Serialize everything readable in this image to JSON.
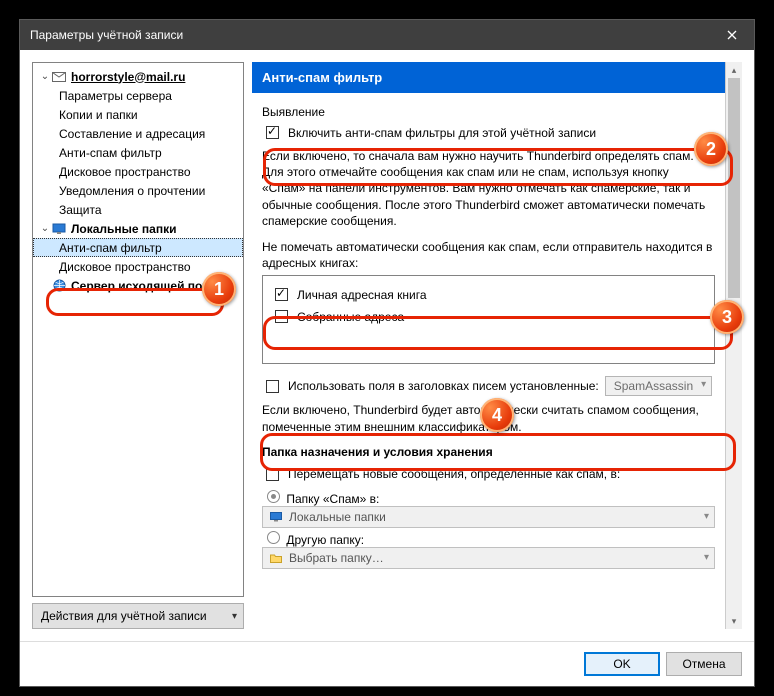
{
  "window": {
    "title": "Параметры учётной записи"
  },
  "sidebar": {
    "account_email": "horrorstyle@mail.ru",
    "items_account": [
      "Параметры сервера",
      "Копии и папки",
      "Составление и адресация",
      "Анти-спам фильтр",
      "Дисковое пространство",
      "Уведомления о прочтении",
      "Защита"
    ],
    "local_folders_label": "Локальные папки",
    "items_local": [
      "Анти-спам фильтр",
      "Дисковое пространство"
    ],
    "outgoing_label": "Сервер исходящей поч…",
    "actions_button": "Действия для учётной записи"
  },
  "panel": {
    "header": "Анти-спам фильтр",
    "section_detection_title": "Выявление",
    "enable_label": "Включить анти-спам фильтры для этой учётной записи",
    "enable_checked": true,
    "enable_desc": "Если включено, то сначала вам нужно научить Thunderbird определять спам. Для этого отмечайте сообщения как спам или не спам, используя кнопку «Спам» на панели инструментов. Вам нужно отмечать как спамерские, так и обычные сообщения. После этого Thunderbird сможет автоматически помечать спамерские сообщения.",
    "ab_desc": "Не помечать автоматически сообщения как спам, если отправитель находится в адресных книгах:",
    "ab_personal_label": "Личная адресная книга",
    "ab_personal_checked": true,
    "ab_collected_label": "Собранные адреса",
    "ab_collected_checked": false,
    "headers_label": "Использовать поля в заголовках писем установленные:",
    "headers_checked": false,
    "headers_select_value": "SpamAssassin",
    "headers_desc": "Если включено, Thunderbird будет автоматически считать спамом сообщения, помеченные этим внешним классификатором.",
    "dest_section_title": "Папка назначения и условия хранения",
    "move_label": "Перемещать новые сообщения, определённые как спам, в:",
    "move_checked": false,
    "radio_junk_label": "Папку «Спам» в:",
    "radio_junk_select": "Локальные папки",
    "radio_other_label": "Другую папку:",
    "radio_other_select": "Выбрать папку…"
  },
  "footer": {
    "ok": "OK",
    "cancel": "Отмена"
  },
  "annotations": {
    "b1": "1",
    "b2": "2",
    "b3": "3",
    "b4": "4"
  }
}
